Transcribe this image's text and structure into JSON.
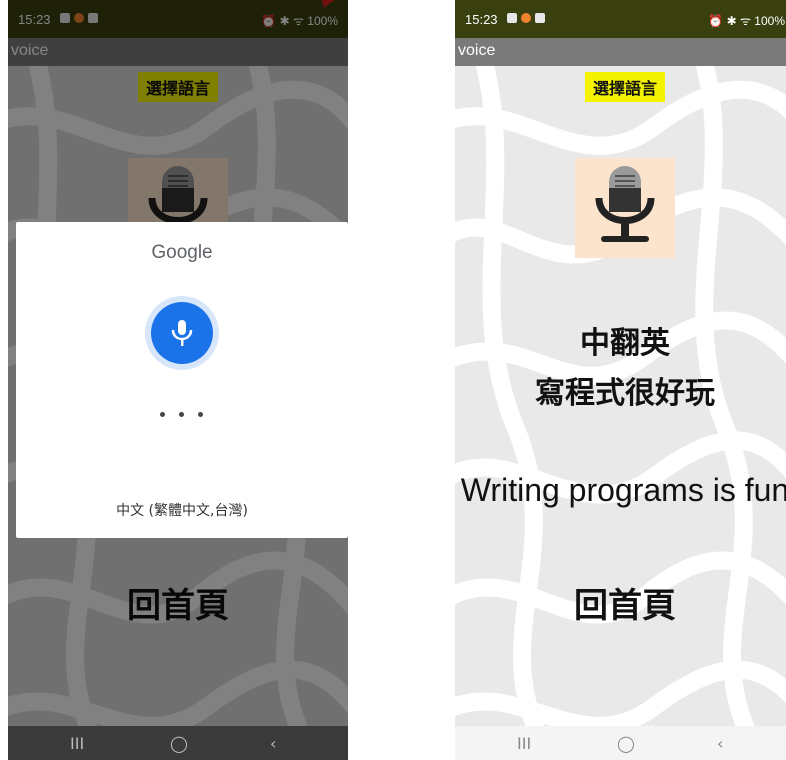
{
  "status_bar": {
    "time": "15:23",
    "right_icons": "⏰ ✱ ᯤ 100%"
  },
  "app": {
    "title": "voice",
    "language_button": "選擇語言",
    "home_button": "回首頁"
  },
  "google_dialog": {
    "title": "Google",
    "dots": "• • •",
    "language": "中文 (繁體中文,台灣)"
  },
  "result": {
    "mode": "中翻英",
    "source_text": "寫程式很好玩",
    "translation": "Writing programs is fun"
  },
  "nav_bar": {
    "recents": "III",
    "home": "◯",
    "back": "‹"
  },
  "colors": {
    "status_bar": "#3a3f0f",
    "title_bar": "#7a7a7a",
    "language_button": "#f3f300",
    "google_mic": "#1a73e8"
  }
}
